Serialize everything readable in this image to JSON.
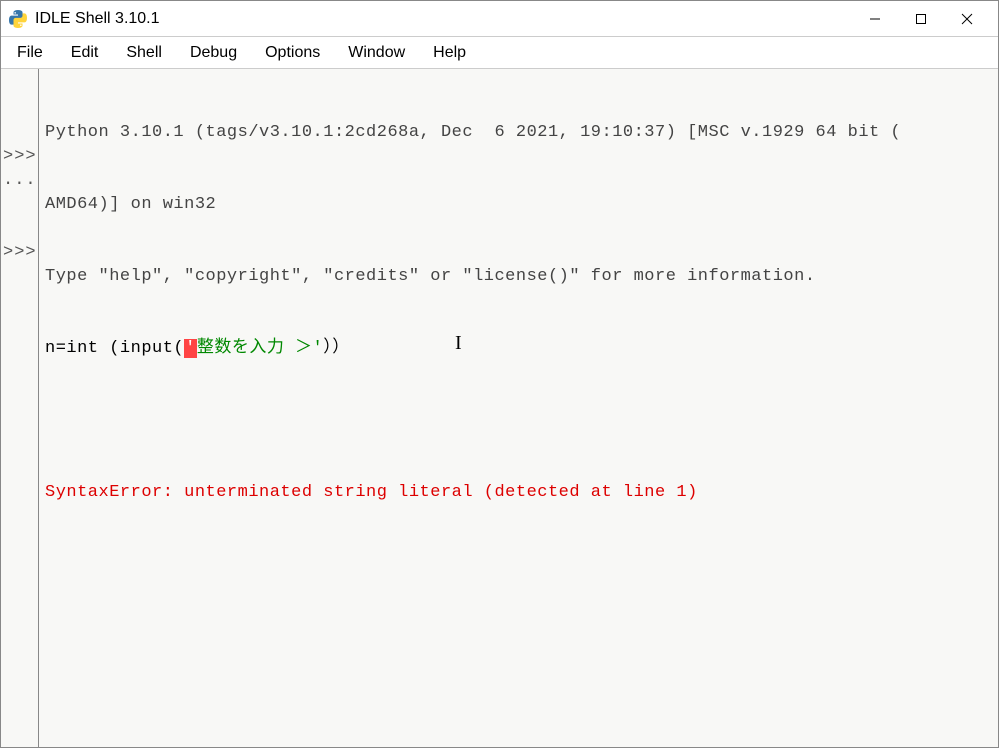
{
  "window": {
    "title": "IDLE Shell 3.10.1"
  },
  "menu": {
    "file": "File",
    "edit": "Edit",
    "shell": "Shell",
    "debug": "Debug",
    "options": "Options",
    "window": "Window",
    "help": "Help"
  },
  "gutter": {
    "prompt1": ">>>",
    "dots": "...",
    "prompt2": ">>>"
  },
  "shell": {
    "banner_line1": "Python 3.10.1 (tags/v3.10.1:2cd268a, Dec  6 2021, 19:10:37) [MSC v.1929 64 bit (",
    "banner_line2": "AMD64)] on win32",
    "banner_line3": "Type \"help\", \"copyright\", \"credits\" or \"license()\" for more information.",
    "code_prefix": "n=int (input(",
    "code_hl": "'",
    "code_string": "整数を入力 ＞'",
    "code_suffix": "））",
    "error": "SyntaxError: unterminated string literal (detected at line 1)"
  }
}
